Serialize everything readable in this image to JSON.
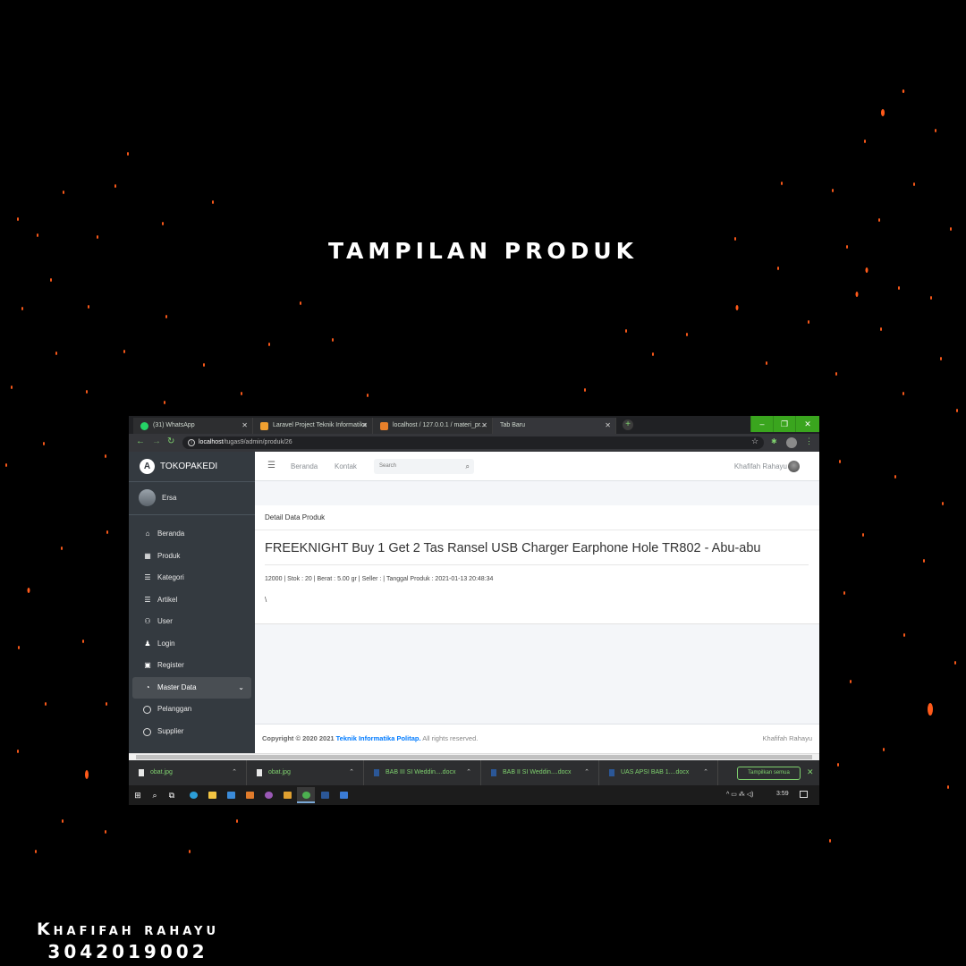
{
  "poster": {
    "title": "TAMPILAN PRODUK",
    "author_name": "Khafifah rahayu",
    "author_id": "3042019002",
    "accent_color": "#ff5a1a"
  },
  "browser": {
    "tabs": [
      {
        "label": "(31) WhatsApp",
        "icon": "whatsapp-icon"
      },
      {
        "label": "Laravel Project Teknik Informatika",
        "icon": "laravel-icon"
      },
      {
        "label": "localhost / 127.0.0.1 / materi_pr...",
        "icon": "phpmyadmin-icon"
      },
      {
        "label": "Tab Baru",
        "icon": ""
      }
    ],
    "new_tab": "+",
    "window_controls": {
      "minimize": "–",
      "restore": "❐",
      "close": "✕"
    },
    "url_host": "localhost",
    "url_path": "/tugas9/admin/produk/26",
    "accent_color": "#3aa51e"
  },
  "sidebar": {
    "brand": "TOKOPAKEDI",
    "user": "Ersa",
    "items": [
      {
        "label": "Beranda",
        "icon": "home-icon"
      },
      {
        "label": "Produk",
        "icon": "grid-icon"
      },
      {
        "label": "Kategori",
        "icon": "list-icon"
      },
      {
        "label": "Artikel",
        "icon": "list-icon"
      },
      {
        "label": "User",
        "icon": "users-icon"
      },
      {
        "label": "Login",
        "icon": "login-icon"
      },
      {
        "label": "Register",
        "icon": "register-icon"
      },
      {
        "label": "Master Data",
        "icon": "dashboard-icon"
      },
      {
        "label": "Pelanggan",
        "icon": "circle-icon"
      },
      {
        "label": "Supplier",
        "icon": "circle-icon"
      }
    ]
  },
  "topnav": {
    "links": [
      "Beranda",
      "Kontak"
    ],
    "search_placeholder": "Search",
    "user": "Khafifah Rahayu"
  },
  "content": {
    "card_header": "Detail Data Produk",
    "product_title": "FREEKNIGHT Buy 1 Get 2 Tas Ransel USB Charger Earphone Hole TR802 - Abu-abu",
    "product_meta": "12000 | Stok : 20 | Berat : 5.00 gr | Seller : | Tanggal Produk : 2021-01-13 20:48:34",
    "product_desc": "\\"
  },
  "footer": {
    "copyright_prefix": "Copyright © 2020 2021 ",
    "copyright_link": "Teknik Informatika Politap.",
    "copyright_suffix": " All rights reserved.",
    "right": "Khafifah Rahayu"
  },
  "downloads": {
    "items": [
      "obat.jpg",
      "obat.jpg",
      "BAB III SI Weddin....docx",
      "BAB II SI Weddin....docx",
      "UAS APSI BAB 1....docx"
    ],
    "show_all": "Tampilkan semua",
    "close": "✕"
  },
  "taskbar": {
    "tray": "^ ▭ ⁂ ◁)",
    "time": "3:59"
  }
}
